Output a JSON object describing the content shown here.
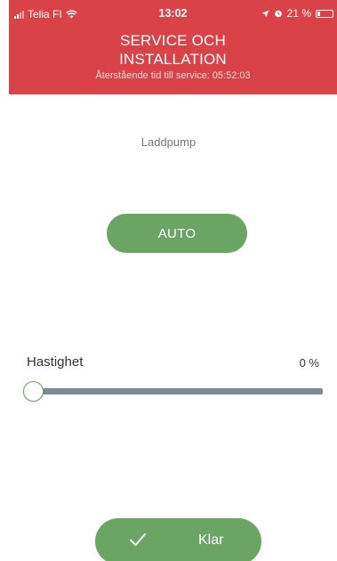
{
  "status_bar": {
    "carrier": "Telia FI",
    "time": "13:02",
    "battery": "21 %"
  },
  "header": {
    "title_line1": "SERVICE OCH",
    "title_line2": "INSTALLATION",
    "subtitle": "Återstående tid till service: 05:52:03"
  },
  "section": {
    "label": "Laddpump"
  },
  "mode_button": {
    "label": "AUTO"
  },
  "speed": {
    "label": "Hastighet",
    "value_text": "0 %",
    "value_fraction": 0
  },
  "done_button": {
    "label": "Klar"
  },
  "colors": {
    "header": "#d94347",
    "accent": "#6aa564",
    "track": "#7e8a93"
  }
}
